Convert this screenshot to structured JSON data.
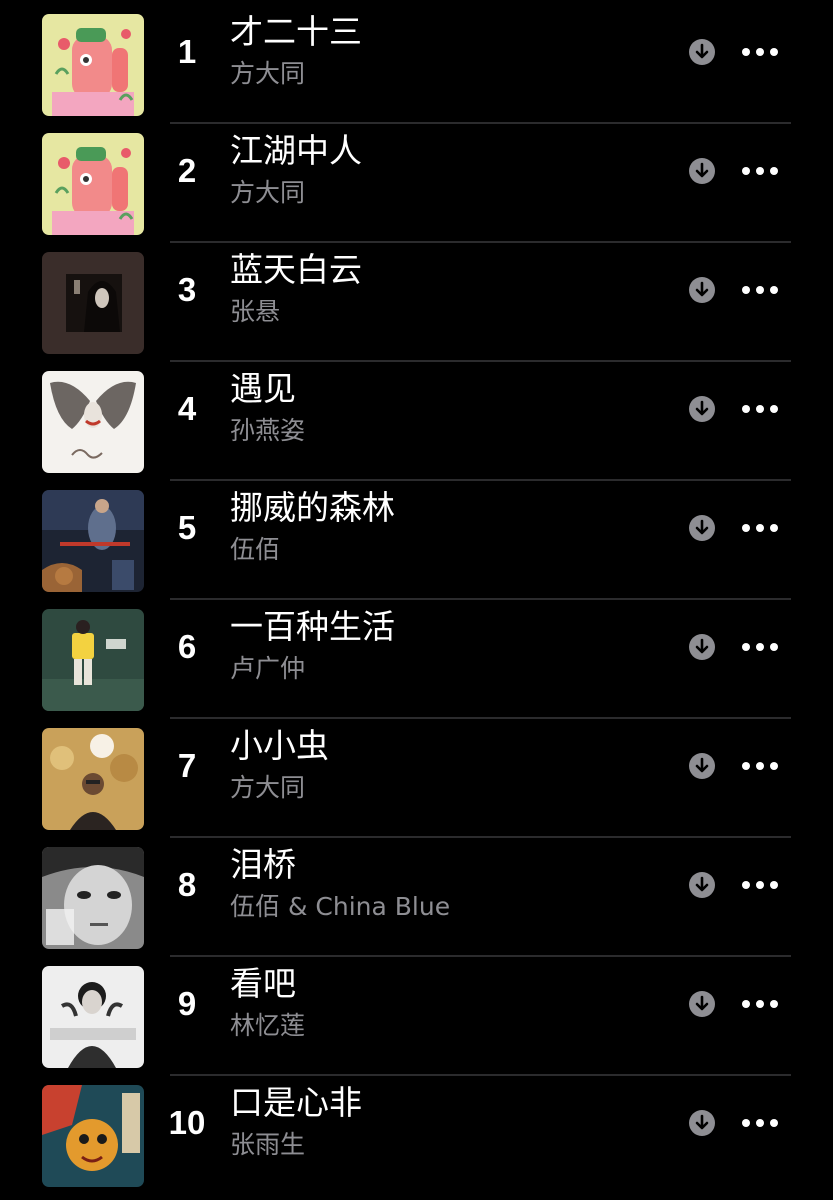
{
  "songs": [
    {
      "rank": "1",
      "title": "才二十三",
      "artist": "方大同",
      "cover_icon": "album-cover-pink-figure"
    },
    {
      "rank": "2",
      "title": "江湖中人",
      "artist": "方大同",
      "cover_icon": "album-cover-pink-figure"
    },
    {
      "rank": "3",
      "title": "蓝天白云",
      "artist": "张悬",
      "cover_icon": "album-cover-dark-portrait"
    },
    {
      "rank": "4",
      "title": "遇见",
      "artist": "孙燕姿",
      "cover_icon": "album-cover-white-wings"
    },
    {
      "rank": "5",
      "title": "挪威的森林",
      "artist": "伍佰",
      "cover_icon": "album-cover-blue-stage"
    },
    {
      "rank": "6",
      "title": "一百种生活",
      "artist": "卢广仲",
      "cover_icon": "album-cover-green-wall"
    },
    {
      "rank": "7",
      "title": "小小虫",
      "artist": "方大同",
      "cover_icon": "album-cover-orange-moon"
    },
    {
      "rank": "8",
      "title": "泪桥",
      "artist": "伍佰 & China Blue",
      "cover_icon": "album-cover-bw-face"
    },
    {
      "rank": "9",
      "title": "看吧",
      "artist": "林忆莲",
      "cover_icon": "album-cover-open-up"
    },
    {
      "rank": "10",
      "title": "口是心非",
      "artist": "张雨生",
      "cover_icon": "album-cover-painted-face"
    }
  ],
  "icons": {
    "download": "download-icon",
    "more": "more-options-icon"
  },
  "colors": {
    "background": "#000000",
    "title": "#ffffff",
    "artist": "#8e8e93",
    "icon": "#8e8e93",
    "separator": "#2b2b2d"
  }
}
